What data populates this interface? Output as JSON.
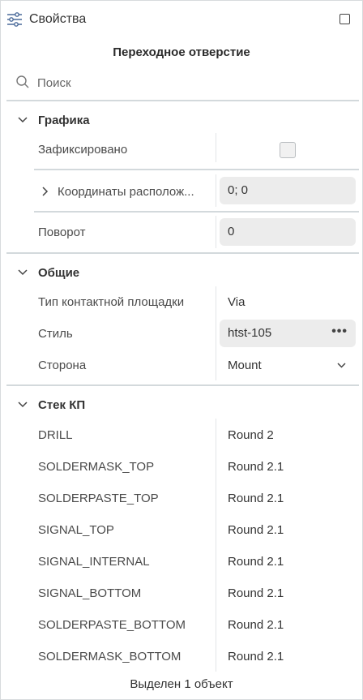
{
  "header": {
    "title": "Свойства",
    "icon": "sliders-icon"
  },
  "object_title": "Переходное отверстие",
  "search": {
    "placeholder": "Поиск",
    "value": ""
  },
  "graphics": {
    "label": "Графика",
    "fixed_label": "Зафиксировано",
    "fixed_checked": false,
    "coords_label": "Координаты располож...",
    "coords_value": "0; 0",
    "rotation_label": "Поворот",
    "rotation_value": "0"
  },
  "general": {
    "label": "Общие",
    "pad_type_label": "Тип контактной площадки",
    "pad_type_value": "Via",
    "style_label": "Стиль",
    "style_value": "htst-105",
    "style_more": "•••",
    "side_label": "Сторона",
    "side_value": "Mount"
  },
  "pad_stack": {
    "label": "Стек КП",
    "rows": [
      {
        "name": "DRILL",
        "value": "Round 2"
      },
      {
        "name": "SOLDERMASK_TOP",
        "value": "Round 2.1"
      },
      {
        "name": "SOLDERPASTE_TOP",
        "value": "Round 2.1"
      },
      {
        "name": "SIGNAL_TOP",
        "value": "Round 2.1"
      },
      {
        "name": "SIGNAL_INTERNAL",
        "value": "Round 2.1"
      },
      {
        "name": "SIGNAL_BOTTOM",
        "value": "Round 2.1"
      },
      {
        "name": "SOLDERPASTE_BOTTOM",
        "value": "Round 2.1"
      },
      {
        "name": "SOLDERMASK_BOTTOM",
        "value": "Round 2.1"
      }
    ]
  },
  "footer": {
    "status": "Выделен 1 объект"
  },
  "colors": {
    "accent": "#4a6a9a",
    "divider": "#d3d9dc",
    "field_bg": "#ececec"
  }
}
